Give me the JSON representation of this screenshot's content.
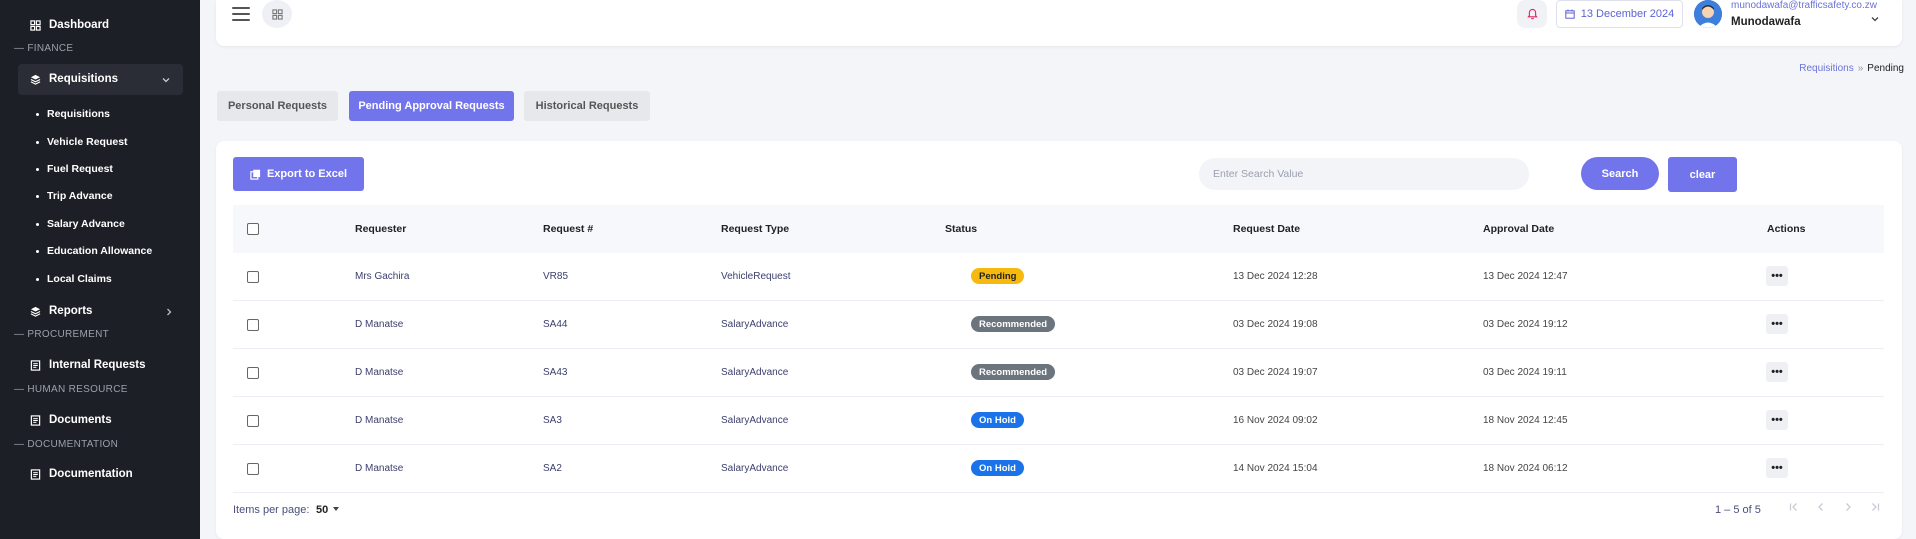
{
  "sidebar": {
    "dashboard": "Dashboard",
    "sections": {
      "finance": "— FINANCE",
      "procurement": "— PROCUREMENT",
      "human_resource": "— HUMAN RESOURCE",
      "documentation": "— DOCUMENTATION"
    },
    "requisitions_group": "Requisitions",
    "sub_items": [
      "Requisitions",
      "Vehicle Request",
      "Fuel Request",
      "Trip Advance",
      "Salary Advance",
      "Education Allowance",
      "Local Claims"
    ],
    "reports": "Reports",
    "internal_requests": "Internal Requests",
    "documents": "Documents",
    "documentation": "Documentation"
  },
  "topbar": {
    "date": "13 December 2024",
    "user_email": "munodawafa@trafficsafety.co.zw",
    "user_name": "Munodawafa"
  },
  "breadcrumb": {
    "parent": "Requisitions",
    "separator": "»",
    "current": "Pending"
  },
  "tabs": [
    "Personal Requests",
    "Pending Approval Requests",
    "Historical Requests"
  ],
  "active_tab_index": 1,
  "toolbar": {
    "export_label": "Export to Excel",
    "search_placeholder": "Enter Search Value",
    "search_value": "",
    "search_label": "Search",
    "clear_label": "clear"
  },
  "table": {
    "columns": [
      "Requester",
      "Request #",
      "Request Type",
      "Status",
      "Request Date",
      "Approval Date",
      "Actions"
    ],
    "rows": [
      {
        "requester": "Mrs Gachira",
        "request_no": "VR85",
        "type": "VehicleRequest",
        "status": "Pending",
        "request_date": "13 Dec 2024 12:28",
        "approval_date": "13 Dec 2024 12:47",
        "action": "•••"
      },
      {
        "requester": "D Manatse",
        "request_no": "SA44",
        "type": "SalaryAdvance",
        "status": "Recommended",
        "request_date": "03 Dec 2024 19:08",
        "approval_date": "03 Dec 2024 19:12",
        "action": "•••"
      },
      {
        "requester": "D Manatse",
        "request_no": "SA43",
        "type": "SalaryAdvance",
        "status": "Recommended",
        "request_date": "03 Dec 2024 19:07",
        "approval_date": "03 Dec 2024 19:11",
        "action": "•••"
      },
      {
        "requester": "D Manatse",
        "request_no": "SA3",
        "type": "SalaryAdvance",
        "status": "On Hold",
        "request_date": "16 Nov 2024 09:02",
        "approval_date": "18 Nov 2024 12:45",
        "action": "•••"
      },
      {
        "requester": "D Manatse",
        "request_no": "SA2",
        "type": "SalaryAdvance",
        "status": "On Hold",
        "request_date": "14 Nov 2024 15:04",
        "approval_date": "18 Nov 2024 06:12",
        "action": "•••"
      }
    ]
  },
  "paginator": {
    "items_per_page_label": "Items per page:",
    "page_size": "50",
    "range_label": "1 – 5 of 5"
  },
  "colors": {
    "accent": "#7274ec",
    "sidebar_bg": "#1c1f26",
    "pending": "#f5b90f",
    "recommended": "#6c757d",
    "on_hold": "#1a73e8"
  }
}
